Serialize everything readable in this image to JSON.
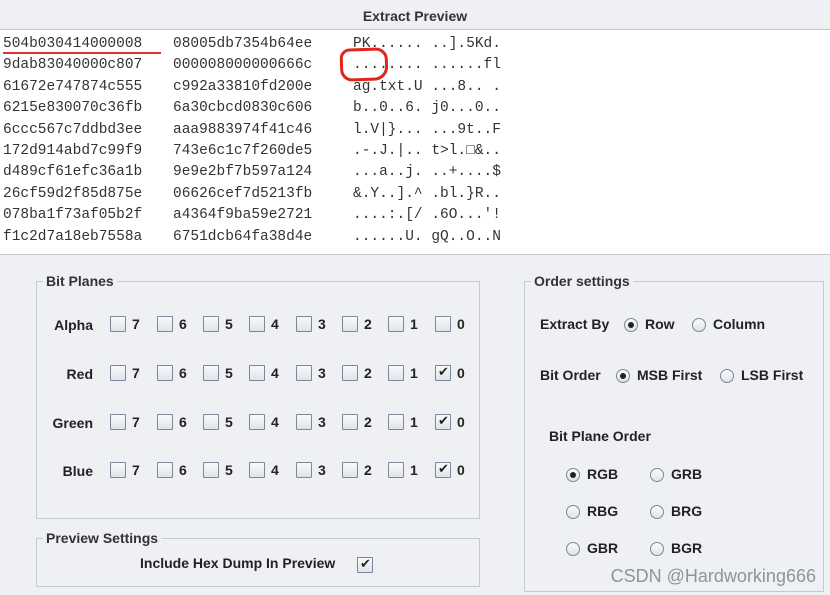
{
  "title": "Extract Preview",
  "preview_rows": [
    {
      "hex1": "504b030414000008",
      "hex2": "08005db7354b64ee",
      "ascii": "PK...... ..].5Kd."
    },
    {
      "hex1": "9dab83040000c807",
      "hex2": "000008000000666c",
      "ascii": "........ ......fl"
    },
    {
      "hex1": "61672e747874c555",
      "hex2": "c992a33810fd200e",
      "ascii": "ag.txt.U ...8.. ."
    },
    {
      "hex1": "6215e830070c36fb",
      "hex2": "6a30cbcd0830c606",
      "ascii": "b..0..6. j0...0.."
    },
    {
      "hex1": "6ccc567c7ddbd3ee",
      "hex2": "aaa9883974f41c46",
      "ascii": "l.V|}... ...9t..F"
    },
    {
      "hex1": "172d914abd7c99f9",
      "hex2": "743e6c1c7f260de5",
      "ascii": ".-.J.|.. t>l.□&.."
    },
    {
      "hex1": "d489cf61efc36a1b",
      "hex2": "9e9e2bf7b597a124",
      "ascii": "...a..j. ..+....$"
    },
    {
      "hex1": "26cf59d2f85d875e",
      "hex2": "06626cef7d5213fb",
      "ascii": "&.Y..].^ .bl.}R.."
    },
    {
      "hex1": "078ba1f73af05b2f",
      "hex2": "a4364f9ba59e2721",
      "ascii": "....:.[/ .6O...'!"
    },
    {
      "hex1": "f1c2d7a18eb7558a",
      "hex2": "6751dcb64fa38d4e",
      "ascii": "......U. gQ..O..N"
    }
  ],
  "bit_planes": {
    "title": "Bit Planes",
    "bits": [
      "7",
      "6",
      "5",
      "4",
      "3",
      "2",
      "1",
      "0"
    ],
    "rows": [
      {
        "name": "Alpha",
        "checked": [
          false,
          false,
          false,
          false,
          false,
          false,
          false,
          false
        ]
      },
      {
        "name": "Red",
        "checked": [
          false,
          false,
          false,
          false,
          false,
          false,
          false,
          true
        ]
      },
      {
        "name": "Green",
        "checked": [
          false,
          false,
          false,
          false,
          false,
          false,
          false,
          true
        ]
      },
      {
        "name": "Blue",
        "checked": [
          false,
          false,
          false,
          false,
          false,
          false,
          false,
          true
        ]
      }
    ]
  },
  "preview_settings": {
    "title": "Preview Settings",
    "include_hex_label": "Include Hex Dump In Preview",
    "include_hex_checked": true
  },
  "order_settings": {
    "title": "Order settings",
    "extract_by_label": "Extract By",
    "extract_by_options": [
      {
        "label": "Row",
        "selected": true
      },
      {
        "label": "Column",
        "selected": false
      }
    ],
    "bit_order_label": "Bit Order",
    "bit_order_options": [
      {
        "label": "MSB First",
        "selected": true
      },
      {
        "label": "LSB First",
        "selected": false
      }
    ],
    "bit_plane_order_label": "Bit Plane Order",
    "bit_plane_order_options": [
      {
        "label": "RGB",
        "selected": true
      },
      {
        "label": "GRB",
        "selected": false
      },
      {
        "label": "RBG",
        "selected": false
      },
      {
        "label": "BRG",
        "selected": false
      },
      {
        "label": "GBR",
        "selected": false
      },
      {
        "label": "BGR",
        "selected": false
      }
    ]
  },
  "watermark": "CSDN @Hardworking666",
  "colors": {
    "panel_bg": "#eef0f3",
    "annotation_red": "#e0251e"
  }
}
